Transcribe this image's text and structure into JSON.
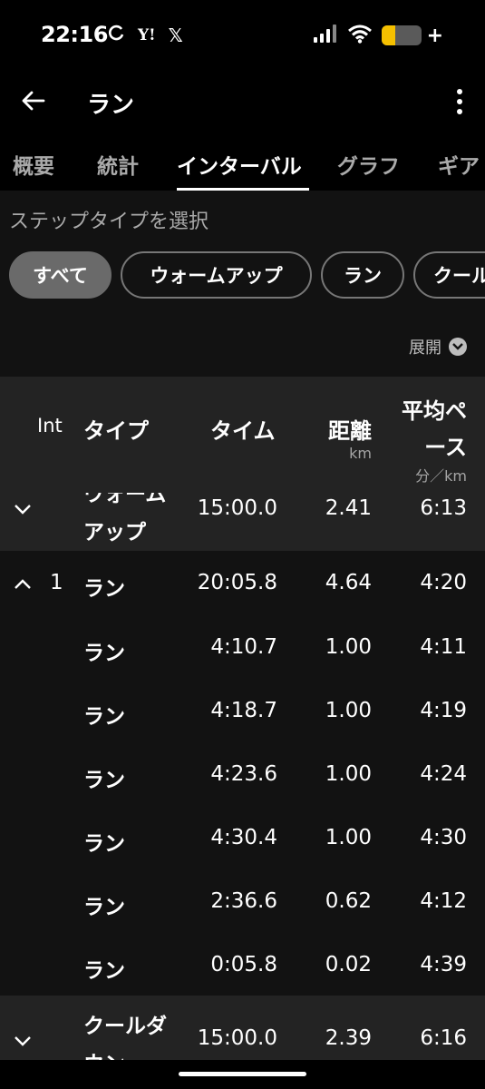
{
  "status": {
    "time": "22:16",
    "left_icons": [
      "sync-icon",
      "yahoo-icon",
      "x-icon"
    ],
    "yahoo_text": "Y!",
    "x_text": "𝕏",
    "battery_level": 0.35,
    "battery_color": "#f5c000"
  },
  "appbar": {
    "title": "ラン"
  },
  "tabs": [
    {
      "label": "概要"
    },
    {
      "label": "統計"
    },
    {
      "label": "インターバル",
      "active": true
    },
    {
      "label": "グラフ"
    },
    {
      "label": "ギア"
    }
  ],
  "filter": {
    "title": "ステップタイプを選択",
    "chips": [
      {
        "label": "すべて",
        "selected": true
      },
      {
        "label": "ウォームアップ"
      },
      {
        "label": "ラン"
      },
      {
        "label": "クール"
      }
    ],
    "expand_label": "展開"
  },
  "table": {
    "headers": {
      "int": "Int",
      "type": "タイプ",
      "time": "タイム",
      "distance": "距離",
      "distance_unit": "km",
      "pace_line1": "平均ペ",
      "pace_line2": "ース",
      "pace_unit": "分／km"
    },
    "rows": [
      {
        "kind": "group",
        "expanded": false,
        "int": "",
        "type_line1": "ウォーム",
        "type_line2": "アップ",
        "time": "15:00.0",
        "distance": "2.41",
        "pace": "6:13"
      },
      {
        "kind": "group",
        "expanded": true,
        "int": "1",
        "type_line1": "ラン",
        "type_line2": "",
        "time": "20:05.8",
        "distance": "4.64",
        "pace": "4:20"
      },
      {
        "kind": "sub",
        "type_line1": "ラン",
        "time": "4:10.7",
        "distance": "1.00",
        "pace": "4:11"
      },
      {
        "kind": "sub",
        "type_line1": "ラン",
        "time": "4:18.7",
        "distance": "1.00",
        "pace": "4:19"
      },
      {
        "kind": "sub",
        "type_line1": "ラン",
        "time": "4:23.6",
        "distance": "1.00",
        "pace": "4:24"
      },
      {
        "kind": "sub",
        "type_line1": "ラン",
        "time": "4:30.4",
        "distance": "1.00",
        "pace": "4:30"
      },
      {
        "kind": "sub",
        "type_line1": "ラン",
        "time": "2:36.6",
        "distance": "0.62",
        "pace": "4:12"
      },
      {
        "kind": "sub",
        "type_line1": "ラン",
        "time": "0:05.8",
        "distance": "0.02",
        "pace": "4:39"
      },
      {
        "kind": "group",
        "expanded": false,
        "int": "",
        "type_line1": "クールダ",
        "type_line2": "ウン",
        "time": "15:00.0",
        "distance": "2.39",
        "pace": "6:16"
      }
    ]
  }
}
